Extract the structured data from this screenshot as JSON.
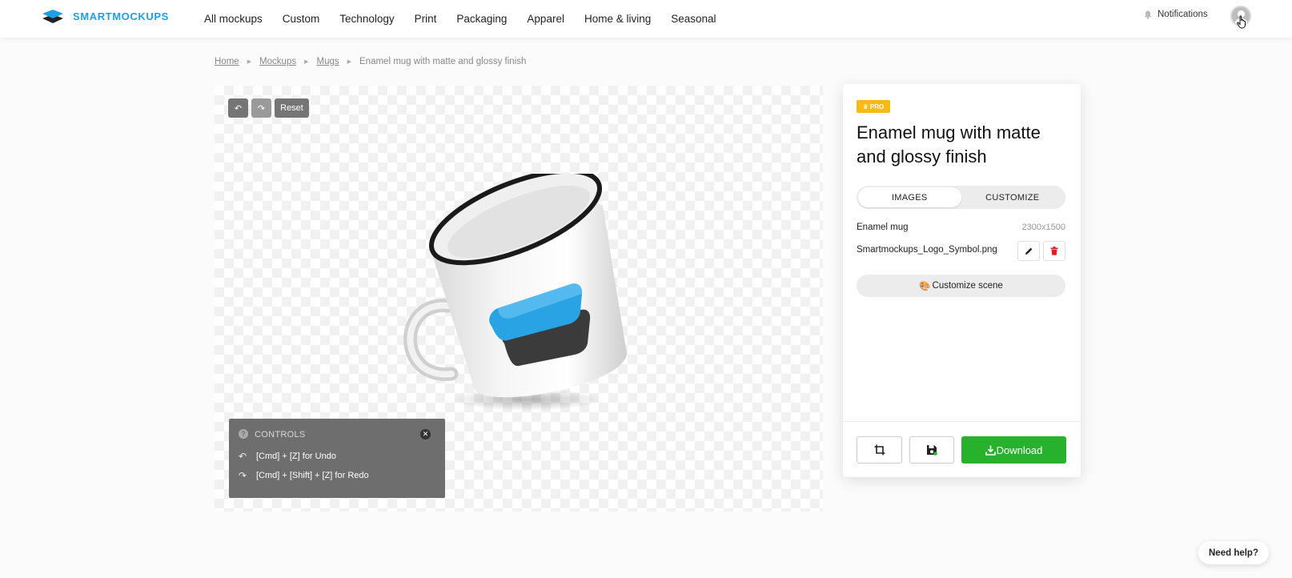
{
  "brand": {
    "name": "SMARTMOCKUPS",
    "accent": "#1ea0e6"
  },
  "nav": {
    "items": [
      "All mockups",
      "Custom",
      "Technology",
      "Print",
      "Packaging",
      "Apparel",
      "Home & living",
      "Seasonal"
    ]
  },
  "header": {
    "notifications_label": "Notifications",
    "bell_icon": "bell-icon",
    "avatar_icon": "user-avatar-icon"
  },
  "breadcrumb": {
    "items": [
      "Home",
      "Mockups",
      "Mugs"
    ],
    "current": "Enamel mug with matte and glossy finish"
  },
  "editor": {
    "undo_icon": "undo-icon",
    "redo_icon": "redo-icon",
    "reset_label": "Reset",
    "controls": {
      "title": "CONTROLS",
      "undo_hint": "[Cmd] + [Z] for Undo",
      "redo_hint": "[Cmd] + [Shift] + [Z] for Redo"
    }
  },
  "panel": {
    "badge": "PRO",
    "title": "Enamel mug with matte and glossy finish",
    "tabs": [
      "IMAGES",
      "CUSTOMIZE"
    ],
    "active_tab": "IMAGES",
    "image_name": "Enamel mug",
    "image_size": "2300x1500",
    "file_name": "Smartmockups_Logo_Symbol.png",
    "customize_scene_label": "Customize scene",
    "download_label": "Download",
    "download_color": "#27b12c"
  },
  "help": {
    "label": "Need help?"
  }
}
